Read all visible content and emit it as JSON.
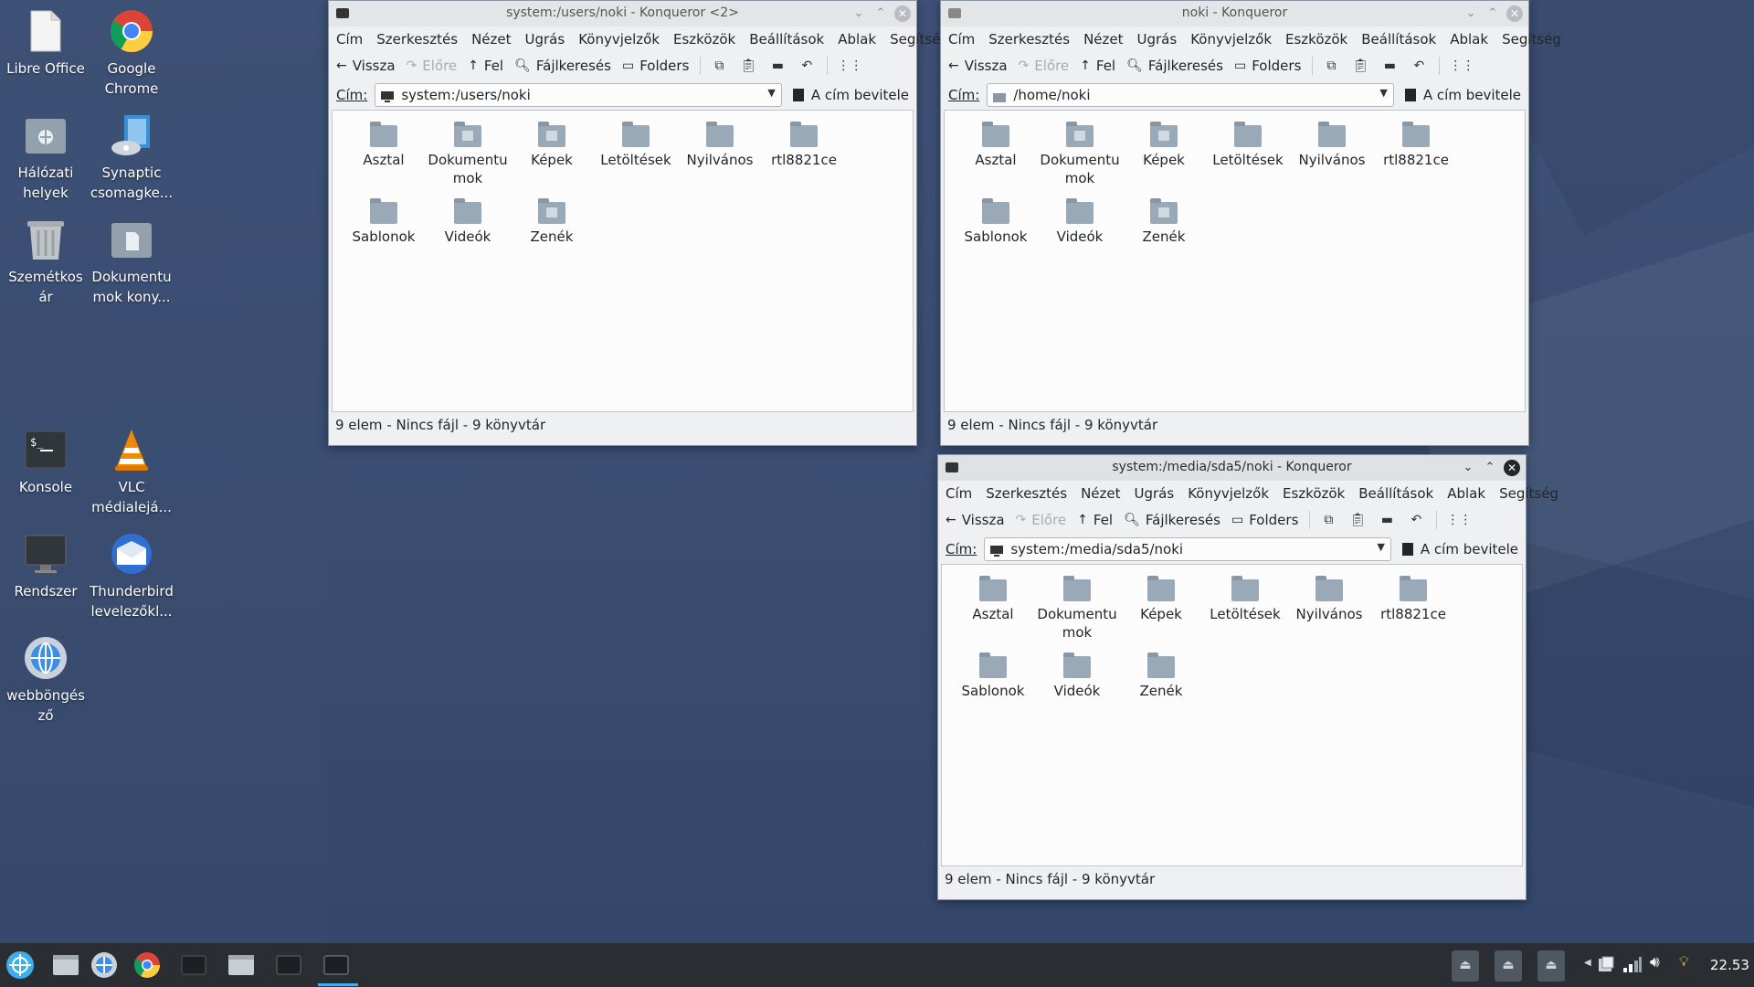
{
  "desktop": {
    "icons": [
      {
        "label": "Libre Office",
        "icon": "libreoffice-icon"
      },
      {
        "label": "Google Chrome",
        "icon": "chrome-icon"
      },
      {
        "label": "Hálózati helyek",
        "icon": "network-folder-icon"
      },
      {
        "label": "Synaptic csomagke...",
        "icon": "synaptic-icon"
      },
      {
        "label": "Szemétkosár",
        "icon": "trash-icon"
      },
      {
        "label": "Dokumentumok köny...",
        "icon": "documents-folder-icon"
      },
      {
        "label": "Konsole",
        "icon": "terminal-icon"
      },
      {
        "label": "VLC médialejáts...",
        "icon": "vlc-icon"
      },
      {
        "label": "Rendszer",
        "icon": "monitor-icon"
      },
      {
        "label": "Thunderbird levelezőkl...",
        "icon": "thunderbird-icon"
      },
      {
        "label": "webböngésző",
        "icon": "web-browser-icon"
      }
    ],
    "icon_lines": {
      "libre": [
        "Libre Office"
      ],
      "chrome": [
        "Google",
        "Chrome"
      ],
      "network": [
        "Hálózati",
        "helyek"
      ],
      "synaptic": [
        "Synaptic",
        "csomagke..."
      ],
      "trash": [
        "Szemétkos",
        "ár"
      ],
      "docs": [
        "Dokumentu",
        "mok kony..."
      ],
      "konsole": [
        "Konsole"
      ],
      "vlc": [
        "VLC",
        "médialejá..."
      ],
      "rendszer": [
        "Rendszer"
      ],
      "thunderbird": [
        "Thunderbird",
        "levelezőkl..."
      ],
      "web": [
        "webböngés",
        "ző"
      ]
    }
  },
  "menu": [
    "Cím",
    "Szerkesztés",
    "Nézet",
    "Ugrás",
    "Könyvjelzők",
    "Eszközök",
    "Beállítások",
    "Ablak",
    "Segítség"
  ],
  "toolbar": {
    "back": "Vissza",
    "forward": "Előre",
    "up": "Fel",
    "search": "Fájlkeresés",
    "folders": "Folders"
  },
  "address": {
    "label": "Cím:",
    "enter_button": "A cím bevitele"
  },
  "folders": [
    {
      "line1": "Asztal",
      "line2": "",
      "mark": ""
    },
    {
      "line1": "Dokumentu",
      "line2": "mok",
      "mark": "doc"
    },
    {
      "line1": "Képek",
      "line2": "",
      "mark": "img"
    },
    {
      "line1": "Letöltések",
      "line2": "",
      "mark": ""
    },
    {
      "line1": "Nyilvános",
      "line2": "",
      "mark": ""
    },
    {
      "line1": "rtl8821ce",
      "line2": "",
      "mark": ""
    },
    {
      "line1": "Sablonok",
      "line2": "",
      "mark": ""
    },
    {
      "line1": "Videók",
      "line2": "",
      "mark": ""
    },
    {
      "line1": "Zenék",
      "line2": "",
      "mark": "music"
    }
  ],
  "windows": [
    {
      "title": "system:/users/noki - Konqueror <2>",
      "address": "system:/users/noki",
      "status": "9 elem - Nincs fájl - 9 könyvtár"
    },
    {
      "title": "noki - Konqueror",
      "address": "/home/noki",
      "status": "9 elem - Nincs fájl - 9 könyvtár"
    },
    {
      "title": "system:/media/sda5/noki - Konqueror",
      "address": "system:/media/sda5/noki",
      "status": "9 elem - Nincs fájl - 9 könyvtár"
    }
  ],
  "taskbar": {
    "clock": "22.53"
  },
  "colors": {
    "accent": "#3daee9",
    "desktop": "#3b4e70",
    "taskbar": "#2a2e32"
  }
}
